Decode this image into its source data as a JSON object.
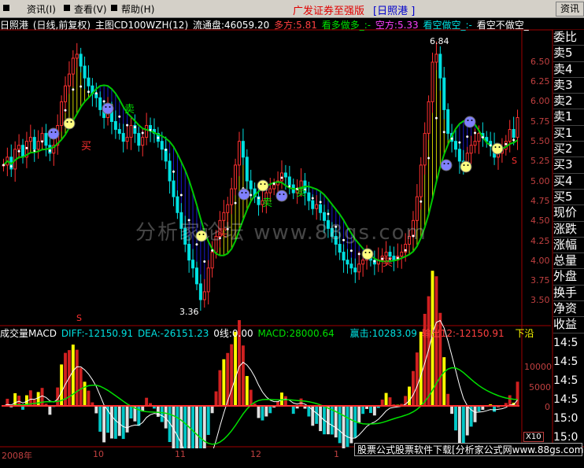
{
  "menu": {
    "items": [
      "资讯(I)",
      "查看(V)",
      "帮助(H)"
    ],
    "title": "广发证券至强版",
    "period_title": "[日照港  ]",
    "right_button": "资讯"
  },
  "info": {
    "stock": "日照港",
    "mode": "(日线,前复权)",
    "indicator": "主图CD100WZH(12)",
    "float_shares": "流通盘:46059.20",
    "long_line": "多方:5.81",
    "long_signal": "看多做多_:-",
    "short_line": "空方:5.33",
    "short_signal": "看空做空_:-",
    "neutral_signal": "看空不做空_"
  },
  "macd_bar": {
    "name": "成交量MACD",
    "diff": "DIFF:-12150.91",
    "dea": "DEA:-26151.23",
    "zero": "0线:0.00",
    "macd": "MACD:28000.64",
    "buy_strike": "赢击:10283.09",
    "output": "输出12:-12150.91",
    "bottom": "下沿"
  },
  "price_axis": [
    "6.50",
    "6.25",
    "6.00",
    "5.75",
    "5.50",
    "5.25",
    "5.00",
    "4.75",
    "4.50",
    "4.25",
    "4.00",
    "3.75",
    "3.50"
  ],
  "macd_axis": [
    "10000",
    "5000",
    "0"
  ],
  "axis_multiplier": "X10",
  "x_axis": [
    "2008年",
    "10",
    "11",
    "12",
    "1"
  ],
  "annotations": {
    "high": "6.84",
    "low": "3.36",
    "sell": "卖",
    "buy": "买",
    "s": "S"
  },
  "right_panel": {
    "labels": [
      "委比",
      "卖5",
      "卖4",
      "卖3",
      "卖2",
      "卖1",
      "买1",
      "买2",
      "买3",
      "买4",
      "买5",
      "现价",
      "涨跌",
      "涨幅",
      "总量",
      "外盘",
      "换手",
      "净资",
      "收益"
    ],
    "ticks": [
      "14:5",
      "14:5",
      "14:5",
      "14:5",
      "15:0",
      "15:0"
    ]
  },
  "watermark": "分析家论坛 www.88gs.com",
  "banner": "股票公式股票软件下载[分析家公式网www.88gs.com]",
  "colors": {
    "up": "#ff3030",
    "down": "#00e0e0",
    "ma_green": "#00c800",
    "band_yellow": "#ffff00",
    "band_blue": "#2020ff",
    "axis": "#c04040"
  },
  "chart_data": {
    "type": "candlestick",
    "price_range": [
      3.3,
      6.9
    ],
    "close": [
      5.2,
      5.3,
      5.15,
      5.4,
      5.45,
      5.3,
      5.5,
      5.55,
      5.4,
      5.5,
      5.6,
      5.45,
      5.35,
      5.45,
      5.7,
      6.0,
      6.2,
      6.35,
      6.55,
      6.6,
      6.45,
      6.3,
      6.2,
      6.1,
      6.05,
      5.9,
      5.8,
      5.9,
      5.75,
      5.65,
      5.6,
      5.5,
      5.55,
      5.7,
      5.6,
      5.45,
      5.55,
      5.7,
      5.65,
      5.6,
      5.5,
      5.4,
      5.25,
      5.0,
      4.8,
      4.6,
      4.4,
      4.2,
      4.0,
      3.9,
      3.7,
      3.5,
      3.6,
      3.9,
      4.1,
      4.3,
      4.5,
      4.6,
      4.7,
      4.9,
      5.2,
      5.5,
      5.3,
      5.0,
      4.9,
      4.8,
      4.7,
      4.75,
      4.85,
      4.9,
      4.95,
      5.0,
      5.1,
      5.05,
      4.95,
      4.85,
      4.9,
      5.0,
      4.85,
      4.75,
      4.65,
      4.7,
      4.6,
      4.5,
      4.4,
      4.3,
      4.2,
      4.1,
      4.0,
      3.95,
      3.9,
      3.85,
      3.95,
      4.0,
      4.05,
      4.0,
      3.95,
      4.0,
      4.05,
      4.1,
      4.05,
      4.0,
      4.05,
      4.1,
      4.2,
      4.3,
      4.5,
      4.8,
      5.2,
      5.6,
      6.0,
      6.5,
      6.6,
      6.3,
      5.9,
      5.6,
      5.5,
      5.4,
      5.25,
      5.2,
      5.35,
      5.45,
      5.5,
      5.6,
      5.55,
      5.5,
      5.45,
      5.3,
      5.35,
      5.4,
      5.5,
      5.65,
      5.55,
      5.8
    ],
    "ma_long": "green line",
    "dates_label": [
      "2008年",
      "10",
      "11",
      "12",
      "1"
    ]
  }
}
